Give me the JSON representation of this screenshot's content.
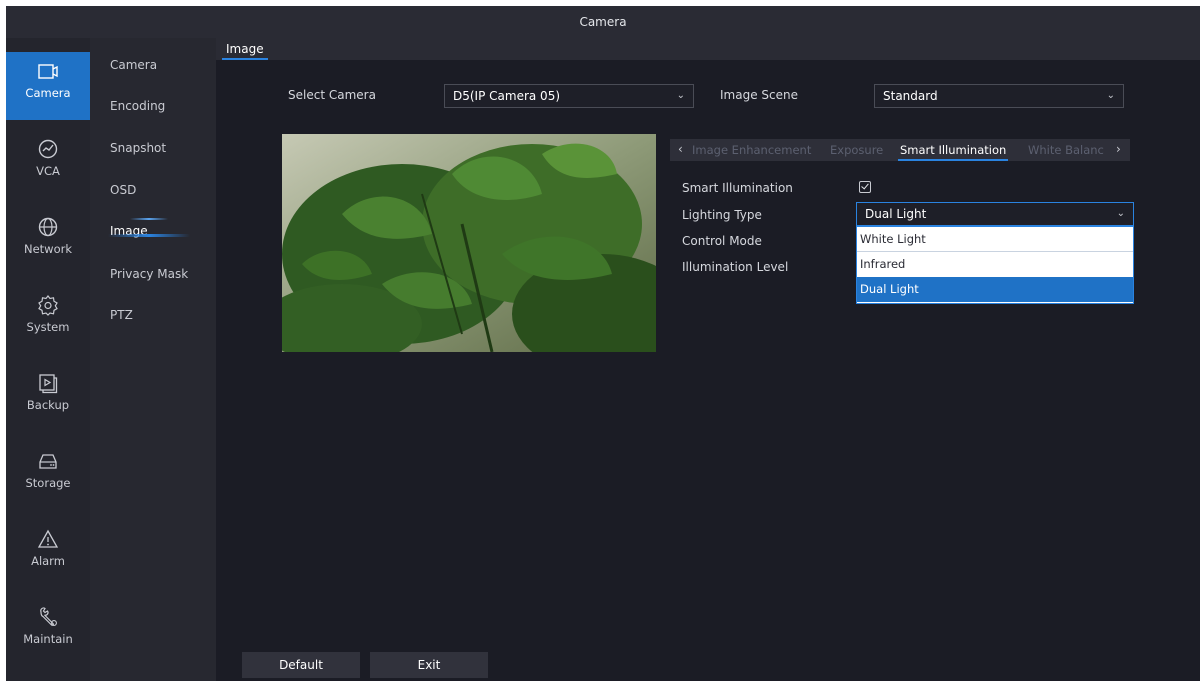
{
  "window": {
    "title": "Camera"
  },
  "nav": [
    {
      "label": "Camera",
      "icon": "camera-icon",
      "active": true
    },
    {
      "label": "VCA",
      "icon": "vca-icon",
      "active": false
    },
    {
      "label": "Network",
      "icon": "globe-icon",
      "active": false
    },
    {
      "label": "System",
      "icon": "gear-icon",
      "active": false
    },
    {
      "label": "Backup",
      "icon": "backup-icon",
      "active": false
    },
    {
      "label": "Storage",
      "icon": "hdd-icon",
      "active": false
    },
    {
      "label": "Alarm",
      "icon": "warning-icon",
      "active": false
    },
    {
      "label": "Maintain",
      "icon": "wrench-icon",
      "active": false
    }
  ],
  "submenu": [
    {
      "label": "Camera"
    },
    {
      "label": "Encoding"
    },
    {
      "label": "Snapshot"
    },
    {
      "label": "OSD"
    },
    {
      "label": "Image",
      "active": true
    },
    {
      "label": "Privacy Mask"
    },
    {
      "label": "PTZ"
    }
  ],
  "breadcrumb": "Image",
  "form": {
    "select_camera_label": "Select Camera",
    "select_camera_value": "D5(IP Camera 05)",
    "image_scene_label": "Image Scene",
    "image_scene_value": "Standard"
  },
  "tabs": {
    "items": [
      "Image Enhancement",
      "Exposure",
      "Smart Illumination",
      "White Balanc"
    ],
    "active": "Smart Illumination"
  },
  "settings": {
    "smart_illumination_label": "Smart Illumination",
    "smart_illumination_checked": true,
    "lighting_type_label": "Lighting Type",
    "lighting_type_value": "Dual Light",
    "control_mode_label": "Control Mode",
    "illumination_level_label": "Illumination Level"
  },
  "dropdown": {
    "options": [
      "White Light",
      "Infrared",
      "Dual Light"
    ],
    "selected": "Dual Light"
  },
  "buttons": {
    "default_label": "Default",
    "exit_label": "Exit"
  },
  "colors": {
    "accent": "#1f72c6",
    "background": "#1b1c25",
    "nav": "#24252d"
  }
}
